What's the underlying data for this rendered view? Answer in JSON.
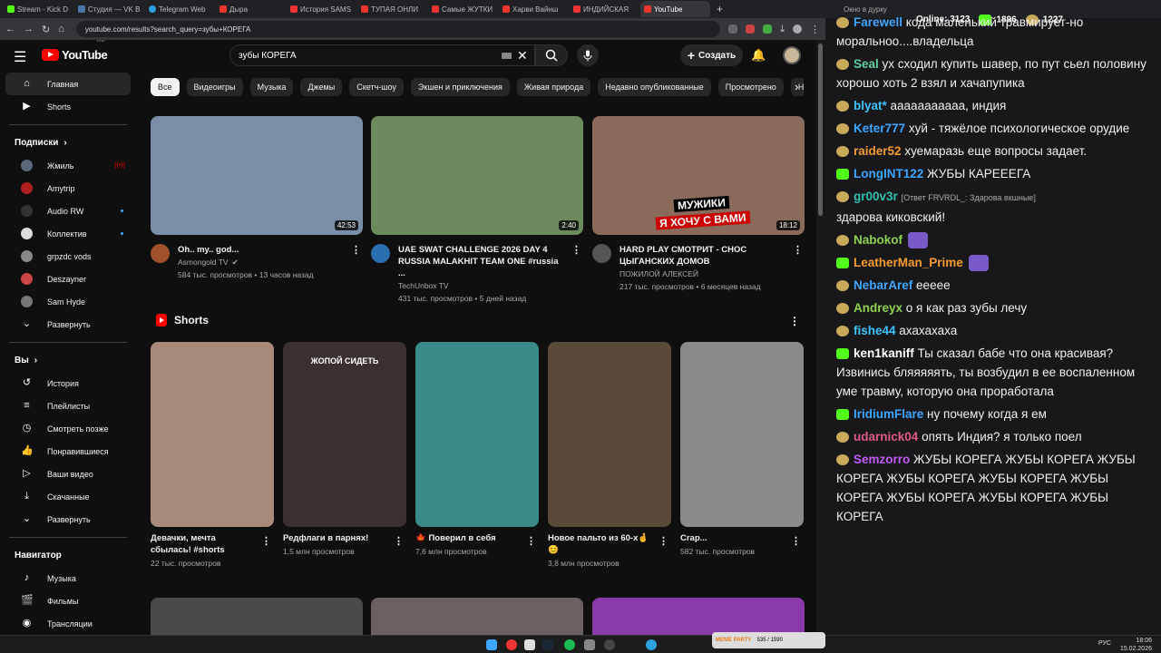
{
  "browser": {
    "tabs": [
      {
        "label": "Stream - Kick D",
        "fav": "kick"
      },
      {
        "label": "Студия — VK В",
        "fav": "vk"
      },
      {
        "label": "Telegram Web",
        "fav": "tg"
      },
      {
        "label": "Дыра",
        "fav": "yt"
      },
      {
        "label": "История SAMS",
        "fav": "yt"
      },
      {
        "label": "ТУПАЯ ОНЛИ",
        "fav": "yt"
      },
      {
        "label": "Самые ЖУТКИ",
        "fav": "yt"
      },
      {
        "label": "Харви Вайнш",
        "fav": "yt"
      },
      {
        "label": "ИНДИЙСКАЯ",
        "fav": "yt"
      },
      {
        "label": "YouTube",
        "fav": "yt"
      }
    ],
    "new_tab": "+",
    "url": "youtube.com/results?search_query=зубы+КОРЕГА"
  },
  "youtube": {
    "logo_text": "YouTube",
    "country": "RU",
    "search_query": "зубы КОРЕГА",
    "create_label": "Создать",
    "sidebar": {
      "main": [
        {
          "label": "Главная",
          "icon": "home-icon",
          "active": true
        },
        {
          "label": "Shorts",
          "icon": "shorts-icon"
        }
      ],
      "subs_header": "Подписки",
      "subs": [
        {
          "label": "Жмиль",
          "color": "#5a6a7a",
          "badge": "live"
        },
        {
          "label": "Amytrip",
          "color": "#b02020"
        },
        {
          "label": "Audio RW",
          "color": "#333",
          "badge": "dot"
        },
        {
          "label": "Коллектив",
          "color": "#ddd",
          "badge": "dot"
        },
        {
          "label": "grpzdc vods",
          "color": "#888"
        },
        {
          "label": "Deszayner",
          "color": "#c44"
        },
        {
          "label": "Sam Hyde",
          "color": "#777"
        },
        {
          "label": "Развернуть",
          "icon": "chevron-down-icon"
        }
      ],
      "you_header": "Вы",
      "you": [
        {
          "label": "История",
          "icon": "history-icon"
        },
        {
          "label": "Плейлисты",
          "icon": "playlist-icon"
        },
        {
          "label": "Смотреть позже",
          "icon": "clock-icon"
        },
        {
          "label": "Понравившиеся",
          "icon": "like-icon"
        },
        {
          "label": "Ваши видео",
          "icon": "video-icon"
        },
        {
          "label": "Скачанные",
          "icon": "download-icon"
        },
        {
          "label": "Развернуть",
          "icon": "chevron-down-icon"
        }
      ],
      "nav_header": "Навигатор",
      "nav": [
        {
          "label": "Музыка",
          "icon": "music-icon"
        },
        {
          "label": "Фильмы",
          "icon": "film-icon"
        },
        {
          "label": "Трансляции",
          "icon": "live-icon"
        }
      ]
    },
    "chips": [
      "Все",
      "Видеоигры",
      "Музыка",
      "Джемы",
      "Скетч-шоу",
      "Экшен и приключения",
      "Живая природа",
      "Недавно опубликованные",
      "Просмотрено",
      "Н"
    ],
    "videos": [
      {
        "title": "Oh.. my.. god...",
        "channel": "Asmongold TV",
        "verified": "✔",
        "meta": "584 тыс. просмотров • 13 часов назад",
        "duration": "42:53",
        "bg": "#7a8ea8",
        "av": "#a0522d"
      },
      {
        "title": "UAE SWAT CHALLENGE 2026 DAY 4 RUSSIA MALAKHIT TEAM ONE #russia ...",
        "channel": "TechUnbox TV",
        "meta": "431 тыс. просмотров • 5 дней назад",
        "duration": "2:40",
        "bg": "#6c8a5c",
        "av": "#2a6fb0"
      },
      {
        "title": "HARD PLAY СМОТРИТ - СНОС ЦЫГАНСКИХ ДОМОВ",
        "channel": "ПОЖИЛОЙ АЛЕКСЕЙ",
        "meta": "217 тыс. просмотров • 6 месяцев назад",
        "duration": "18:12",
        "bg": "#8a6a5a",
        "av": "#555",
        "overlay1": "МУЖИКИ",
        "overlay2": "Я ХОЧУ С ВАМИ"
      }
    ],
    "shorts_title": "Shorts",
    "shorts": [
      {
        "title": "Девачки, мечта сбылась! #shorts",
        "views": "22 тыс. просмотров",
        "bg": "#a88a7a"
      },
      {
        "title": "Редфлаги в парнях!",
        "views": "1,5 млн просмотров",
        "bg": "#3a3030",
        "caption": "ЖОПОЙ СИДЕТЬ"
      },
      {
        "title": "🍁 Поверил в себя",
        "views": "7,6 млн просмотров",
        "bg": "#3a8a8a"
      },
      {
        "title": "Новое пальто из 60-х🤞😊",
        "views": "3,8 млн просмотров",
        "bg": "#5a4a3a"
      },
      {
        "title": "Crap...",
        "views": "582 тыс. просмотров",
        "bg": "#8a8a8a"
      }
    ]
  },
  "chat": {
    "window_title": "Окно в дурку",
    "online_label": "Online:",
    "online_count": "3123",
    "stat_a": "1896",
    "stat_b": "1227",
    "messages": [
      {
        "user": "Farewell",
        "color": "#3ea6ff",
        "text": "кода маленький травмирует-но моральноо....владельца",
        "badge": "a"
      },
      {
        "user": "Seal",
        "color": "#5fcf9f",
        "text": "ух сходил купить шавер, по пут сьел половину хорошо хоть 2 взял и хачапупика",
        "badge": "a"
      },
      {
        "user": "blyat*",
        "color": "#3ec4ff",
        "text": "ааааааааааа, индия",
        "badge": "a"
      },
      {
        "user": "Keter777",
        "color": "#3ea6ff",
        "text": "хуй - тяжёлое психологическое орудие",
        "badge": "a"
      },
      {
        "user": "raider52",
        "color": "#f59a2f",
        "text": "хуемаразь еще вопросы задает.",
        "badge": "a"
      },
      {
        "user": "LongINT122",
        "color": "#3ea6ff",
        "text": "ЖУБЫ КАРЕЕЕГА",
        "badge": "k"
      },
      {
        "user": "gr00v3r",
        "color": "#2fc0b0",
        "reply": "[Ответ FRVRDL_: Здарова вкшные]",
        "text": "здарова киковский!",
        "badge": "a"
      },
      {
        "user": "Nabokof",
        "color": "#8fd14f",
        "text": "",
        "badge": "a"
      },
      {
        "user": "LeatherMan_Prime",
        "color": "#f59a2f",
        "text": "",
        "badge": "k"
      },
      {
        "user": "NebarAref",
        "color": "#3ea6ff",
        "text": "eeeee",
        "badge": "a"
      },
      {
        "user": "Andreyx",
        "color": "#8fd14f",
        "text": "о я как раз зубы лечу",
        "badge": "a"
      },
      {
        "user": "fishe44",
        "color": "#3ec4ff",
        "text": "ахахахаха",
        "badge": "a"
      },
      {
        "user": "ken1kaniff",
        "color": "#ffffff",
        "text": "Ты сказал бабе что она красивая? Извинись бляяяяять, ты возбудил в ее воспаленном уме травму, которую она проработала",
        "badge": "k"
      },
      {
        "user": "IridiumFlare",
        "color": "#3ea6ff",
        "text": "ну почему когда я ем",
        "badge": "k"
      },
      {
        "user": "udarnick04",
        "color": "#e05a8a",
        "text": "опять Индия? я только поел",
        "badge": "a"
      },
      {
        "user": "Semzorro",
        "color": "#c05af5",
        "text": "ЖУБЫ КОРЕГА ЖУБЫ КОРЕГА ЖУБЫ КОРЕГА ЖУБЫ КОРЕГА ЖУБЫ КОРЕГА ЖУБЫ КОРЕГА ЖУБЫ КОРЕГА ЖУБЫ КОРЕГА ЖУБЫ КОРЕГА",
        "badge": "a"
      }
    ]
  },
  "taskbar": {
    "lang": "РУС",
    "time": "18:06",
    "date": "15.02.2026",
    "mem_label": "MEME PARTY",
    "mem_value": "535 / 1590"
  }
}
